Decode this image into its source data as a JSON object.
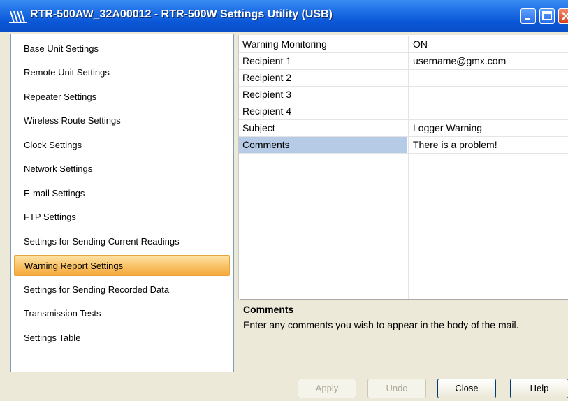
{
  "window": {
    "title": "RTR-500AW_32A00012 - RTR-500W Settings Utility (USB)",
    "icon": "app-logo-icon",
    "controls": [
      "minimize-icon",
      "maximize-icon",
      "close-icon"
    ]
  },
  "sidebar": {
    "items": [
      {
        "label": "Base Unit Settings"
      },
      {
        "label": "Remote Unit Settings"
      },
      {
        "label": "Repeater Settings"
      },
      {
        "label": "Wireless Route Settings"
      },
      {
        "label": "Clock Settings"
      },
      {
        "label": "Network Settings"
      },
      {
        "label": "E-mail Settings"
      },
      {
        "label": "FTP Settings"
      },
      {
        "label": "Settings for Sending Current Readings"
      },
      {
        "label": "Warning Report Settings",
        "selected": true
      },
      {
        "label": "Settings for Sending Recorded Data"
      },
      {
        "label": "Transmission Tests"
      },
      {
        "label": "Settings Table"
      }
    ]
  },
  "properties": {
    "rows": [
      {
        "name": "Warning Monitoring",
        "value": "ON"
      },
      {
        "name": "Recipient 1",
        "value": "username@gmx.com"
      },
      {
        "name": "Recipient 2",
        "value": ""
      },
      {
        "name": "Recipient 3",
        "value": ""
      },
      {
        "name": "Recipient 4",
        "value": ""
      },
      {
        "name": "Subject",
        "value": "Logger Warning"
      },
      {
        "name": "Comments",
        "value": "There is a problem!",
        "selected": true
      }
    ]
  },
  "help": {
    "title": "Comments",
    "description": "Enter any comments you wish to appear in the body of the mail."
  },
  "buttons": {
    "apply": "Apply",
    "undo": "Undo",
    "close": "Close",
    "help": "Help"
  },
  "colors": {
    "titlebar": "#0a56d6",
    "selected_nav": "#f9c46b",
    "selected_row": "#b6cbe6"
  }
}
